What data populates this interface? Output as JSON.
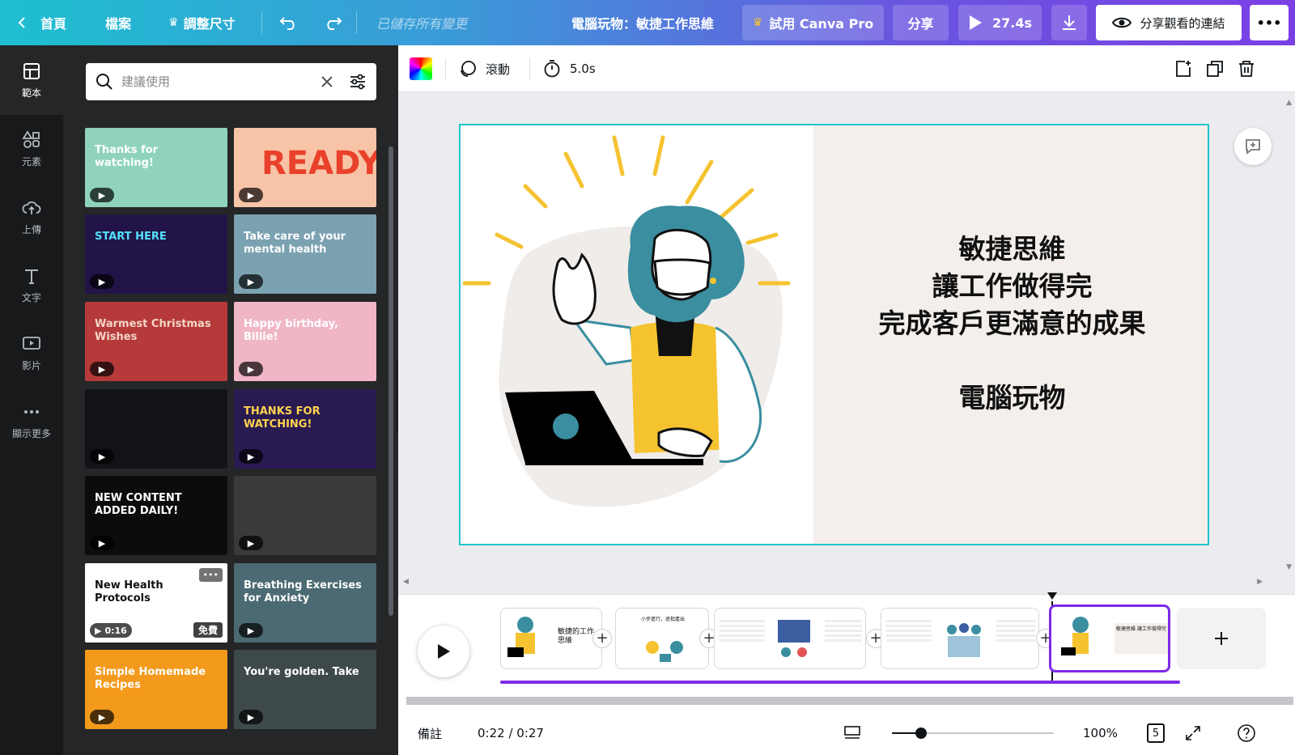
{
  "topbar": {
    "home": "首頁",
    "file": "檔案",
    "resize": "調整尺寸",
    "saved_status": "已儲存所有變更",
    "doc_title": "電腦玩物：敏捷工作思維",
    "try_pro": "試用 Canva Pro",
    "share": "分享",
    "play_duration": "27.4s",
    "share_view_link": "分享觀看的連結",
    "more": "•••"
  },
  "rail": {
    "items": [
      {
        "label": "範本",
        "icon": "template-icon"
      },
      {
        "label": "元素",
        "icon": "elements-icon"
      },
      {
        "label": "上傳",
        "icon": "upload-icon"
      },
      {
        "label": "文字",
        "icon": "text-icon"
      },
      {
        "label": "影片",
        "icon": "video-icon"
      },
      {
        "label": "顯示更多",
        "icon": "more-icon"
      }
    ]
  },
  "panel": {
    "search_placeholder": "建議使用",
    "tiles": [
      {
        "title": "Thanks for watching!",
        "bg": "#8fd3bd",
        "fg": "#ffffff"
      },
      {
        "title": "READY",
        "bg": "#f7c4a7",
        "fg": "#e9412b"
      },
      {
        "title": "START HERE",
        "bg": "#221447",
        "fg": "#53e0ff"
      },
      {
        "title": "Take care of your mental health",
        "bg": "#7ba2b1",
        "fg": "#ffffff"
      },
      {
        "title": "Warmest Christmas Wishes",
        "bg": "#b63a3a",
        "fg": "#f3d6c8"
      },
      {
        "title": "Happy birthday, Billie!",
        "bg": "#f0b6c6",
        "fg": "#ffffff"
      },
      {
        "title": "",
        "bg": "#111319",
        "fg": "#ffffff"
      },
      {
        "title": "THANKS FOR WATCHING!",
        "bg": "#2a1a52",
        "fg": "#ffd34d"
      },
      {
        "title": "NEW CONTENT ADDED DAILY!",
        "bg": "#0c0c0c",
        "fg": "#ffffff"
      },
      {
        "title": "",
        "bg": "#3a3a3a",
        "fg": "#ffffff"
      },
      {
        "title": "New Health Protocols",
        "bg": "#ffffff",
        "fg": "#111111",
        "duration": "0:16",
        "badge": "免費"
      },
      {
        "title": "Breathing Exercises for Anxiety",
        "bg": "#4b6a73",
        "fg": "#ffffff"
      },
      {
        "title": "Simple Homemade Recipes",
        "bg": "#f39a1d",
        "fg": "#ffffff"
      },
      {
        "title": "You're golden. Take",
        "bg": "#3e4a4a",
        "fg": "#ffffff"
      }
    ]
  },
  "editor_toolbar": {
    "animate": "滾動",
    "duration": "5.0s"
  },
  "slide": {
    "lines": [
      "敏捷思維",
      "讓工作做得完",
      "完成客戶更滿意的成果",
      "",
      "電腦玩物"
    ]
  },
  "timeline": {
    "thumbs": [
      {
        "text": "敏捷的工作思維"
      },
      {
        "text": "小步進行，逐批產出"
      },
      {
        "text": ""
      },
      {
        "text": ""
      },
      {
        "text": "敏捷思維 讓工作做得完"
      }
    ]
  },
  "bottombar": {
    "notes": "備註",
    "time": "0:22 / 0:27",
    "zoom": "100%",
    "page_count": "5",
    "zoom_fraction": 0.18
  },
  "colors": {
    "accent_purple": "#7d2ae8",
    "slide_border": "#1fc6cc",
    "illustration_teal": "#3a8ea0",
    "illustration_yellow": "#f5c330"
  }
}
